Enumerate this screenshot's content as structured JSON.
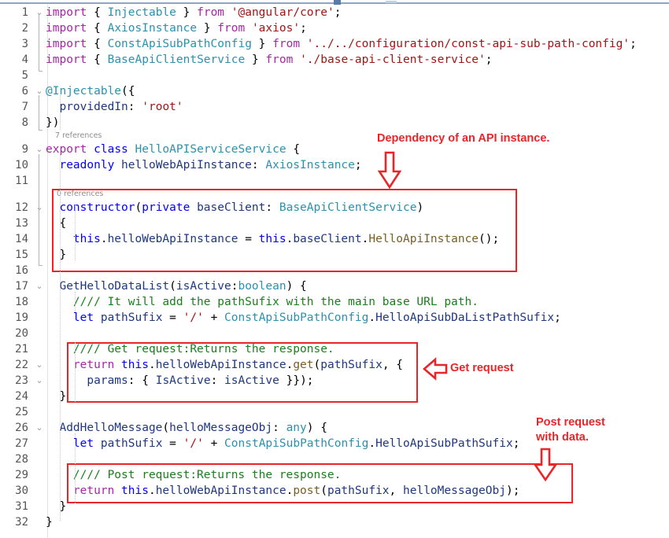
{
  "window": {
    "app": "code-editor",
    "theme_background": "#ffffff"
  },
  "colors": {
    "annotation_red": "#e8262a",
    "keyword_purple": "#a626a4",
    "keyword_blue": "#0000ff",
    "type_teal": "#2b91af",
    "string_darkred": "#a31515",
    "comment_green": "#1a7f1a",
    "identifier_navy": "#1f377f",
    "method_olive": "#795e26",
    "gutter_gray": "#555555",
    "codelens_gray": "#8d8d8d"
  },
  "codelens": {
    "class_refs": "7 references",
    "constructor_refs": "0 references"
  },
  "gutter": {
    "line_numbers": [
      1,
      2,
      3,
      4,
      5,
      6,
      7,
      8,
      9,
      10,
      11,
      12,
      13,
      14,
      15,
      16,
      17,
      18,
      19,
      20,
      21,
      22,
      23,
      24,
      25,
      26,
      27,
      28,
      29,
      30,
      31,
      32
    ]
  },
  "code": {
    "language": "typescript",
    "lines": [
      {
        "n": 1,
        "fold": "v",
        "text": "import { Injectable } from '@angular/core';"
      },
      {
        "n": 2,
        "fold": "",
        "text": "import { AxiosInstance } from 'axios';"
      },
      {
        "n": 3,
        "fold": "",
        "text": "import { ConstApiSubPathConfig } from '../../configuration/const-api-sub-path-config';"
      },
      {
        "n": 4,
        "fold": "",
        "text": "import { BaseApiClientService } from './base-api-client-service';"
      },
      {
        "n": 5,
        "fold": "",
        "text": ""
      },
      {
        "n": 6,
        "fold": "v",
        "text": "@Injectable({"
      },
      {
        "n": 7,
        "fold": "",
        "text": "  providedIn: 'root'"
      },
      {
        "n": 8,
        "fold": "",
        "text": "})"
      },
      {
        "n": 9,
        "fold": "v",
        "text": "export class HelloAPIServiceService {"
      },
      {
        "n": 10,
        "fold": "",
        "text": "  readonly helloWebApiInstance: AxiosInstance;"
      },
      {
        "n": 11,
        "fold": "",
        "text": ""
      },
      {
        "n": 12,
        "fold": "v",
        "text": "  constructor(private baseClient: BaseApiClientService)"
      },
      {
        "n": 13,
        "fold": "",
        "text": "  {"
      },
      {
        "n": 14,
        "fold": "",
        "text": "    this.helloWebApiInstance = this.baseClient.HelloApiInstance();"
      },
      {
        "n": 15,
        "fold": "",
        "text": "  }"
      },
      {
        "n": 16,
        "fold": "",
        "text": ""
      },
      {
        "n": 17,
        "fold": "v",
        "text": "  GetHelloDataList(isActive:boolean) {"
      },
      {
        "n": 18,
        "fold": "",
        "text": "    //// It will add the pathSufix with the main base URL path."
      },
      {
        "n": 19,
        "fold": "",
        "text": "    let pathSufix = '/' + ConstApiSubPathConfig.HelloApiSubDaListPathSufix;"
      },
      {
        "n": 20,
        "fold": "",
        "text": ""
      },
      {
        "n": 21,
        "fold": "",
        "text": "    //// Get request:Returns the response."
      },
      {
        "n": 22,
        "fold": "v",
        "text": "    return this.helloWebApiInstance.get(pathSufix, {"
      },
      {
        "n": 23,
        "fold": "v",
        "text": "      params: { IsActive: isActive }});"
      },
      {
        "n": 24,
        "fold": "",
        "text": "  }"
      },
      {
        "n": 25,
        "fold": "",
        "text": ""
      },
      {
        "n": 26,
        "fold": "v",
        "text": "  AddHelloMessage(helloMessageObj: any) {"
      },
      {
        "n": 27,
        "fold": "",
        "text": "    let pathSufix = '/' + ConstApiSubPathConfig.HelloApiSubPathSufix;"
      },
      {
        "n": 28,
        "fold": "",
        "text": ""
      },
      {
        "n": 29,
        "fold": "",
        "text": "    //// Post request:Returns the response."
      },
      {
        "n": 30,
        "fold": "",
        "text": "    return this.helloWebApiInstance.post(pathSufix, helloMessageObj);"
      },
      {
        "n": 31,
        "fold": "",
        "text": "  }"
      },
      {
        "n": 32,
        "fold": "",
        "text": "}"
      }
    ]
  },
  "annotations": [
    {
      "id": "dependency",
      "label": "Dependency of an API instance.",
      "arrow": "down",
      "target": "constructor-highlight-box"
    },
    {
      "id": "get-request",
      "label": "Get request",
      "arrow": "left",
      "target": "get-request-highlight-box"
    },
    {
      "id": "post-request",
      "label_line1": "Post request",
      "label_line2": "with data.",
      "arrow": "down",
      "target": "post-request-highlight-box"
    }
  ],
  "highlight_boxes": [
    {
      "id": "constructor-highlight-box",
      "lines": "12-15"
    },
    {
      "id": "get-request-highlight-box",
      "lines": "21-23"
    },
    {
      "id": "post-request-highlight-box",
      "lines": "29-30"
    }
  ]
}
